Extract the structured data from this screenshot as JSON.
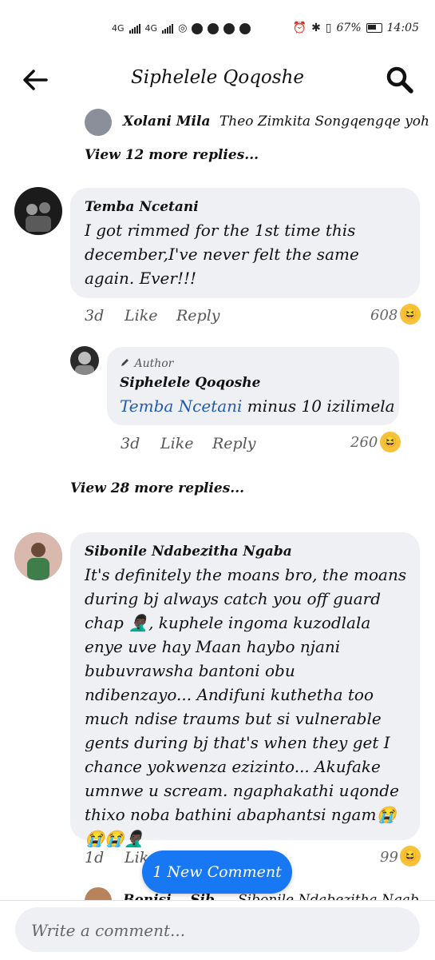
{
  "status_bar": {
    "network_1": "4G",
    "network_2": "4G",
    "battery": "67%",
    "time": "14:05"
  },
  "header": {
    "title": "Siphelele Qoqoshe"
  },
  "top_reply": {
    "author": "Xolani Mila",
    "preview": "Theo Zimkita Songqengqe yoh ..."
  },
  "view_more_1": "View 12 more replies...",
  "comment_1": {
    "author": "Temba Ncetani",
    "text": "I got rimmed for the 1st time this december,I've never felt the same again. Ever!!!",
    "time": "3d",
    "like": "Like",
    "reply": "Reply",
    "reactions": "608"
  },
  "reply_1": {
    "badge": "Author",
    "author": "Siphelele Qoqoshe",
    "mention": "Temba Ncetani",
    "text": " minus 10 izilimela",
    "time": "3d",
    "like": "Like",
    "reply": "Reply",
    "reactions": "260"
  },
  "view_more_2": "View 28 more replies...",
  "comment_2": {
    "author": "Sibonile Ndabezitha Ngaba",
    "text": "It's definitely the moans bro, the moans during bj always catch you off guard chap 🤦🏿‍♂️, kuphele ingoma kuzodlala enye uve hay Maan haybo njani bubuvrawsha bantoni obu ndibenzayo... Andifuni kuthetha too much ndise traums but si vulnerable gents during bj that's when they get I chance yokwenza ezizinto... Akufake umnwe u scream. ngaphakathi uqonde thixo noba bathini abaphantsi ngam😭😭😭🤦🏿‍♂️",
    "time": "1d",
    "like": "Like",
    "reactions": "99"
  },
  "partial_next": {
    "author": "Bonisi... Sib...",
    "preview": "Sibonile Ndabezitha Ngab..."
  },
  "new_comment_button": "1 New Comment",
  "composer": {
    "placeholder": "Write a comment..."
  },
  "icons": {
    "back": "arrow-left-icon",
    "search": "search-icon",
    "haha": "haha-reaction-icon",
    "pencil": "pencil-icon"
  },
  "colors": {
    "accent": "#1877f2",
    "bubble": "#eff0f3",
    "mention": "#1f5ab5"
  }
}
